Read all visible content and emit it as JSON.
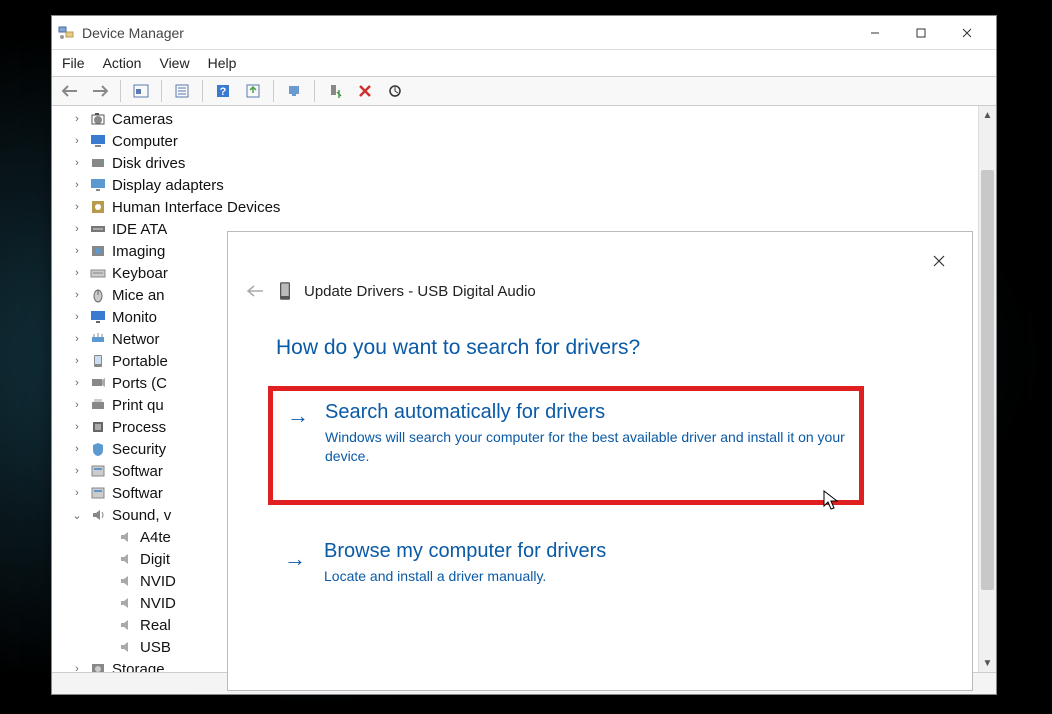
{
  "window": {
    "title": "Device Manager",
    "menu": {
      "file": "File",
      "action": "Action",
      "view": "View",
      "help": "Help"
    }
  },
  "tree": [
    {
      "label": "Cameras",
      "icon": "camera",
      "exp": ">"
    },
    {
      "label": "Computer",
      "icon": "computer",
      "exp": ">"
    },
    {
      "label": "Disk drives",
      "icon": "disk",
      "exp": ">"
    },
    {
      "label": "Display adapters",
      "icon": "display",
      "exp": ">"
    },
    {
      "label": "Human Interface Devices",
      "icon": "hid",
      "exp": ">"
    },
    {
      "label": "IDE ATA",
      "icon": "ide",
      "exp": ">"
    },
    {
      "label": "Imaging",
      "icon": "imaging",
      "exp": ">"
    },
    {
      "label": "Keyboar",
      "icon": "keyboard",
      "exp": ">"
    },
    {
      "label": "Mice an",
      "icon": "mouse",
      "exp": ">"
    },
    {
      "label": "Monito",
      "icon": "monitor",
      "exp": ">"
    },
    {
      "label": "Networ",
      "icon": "network",
      "exp": ">"
    },
    {
      "label": "Portable",
      "icon": "portable",
      "exp": ">"
    },
    {
      "label": "Ports (C",
      "icon": "ports",
      "exp": ">"
    },
    {
      "label": "Print qu",
      "icon": "print",
      "exp": ">"
    },
    {
      "label": "Process",
      "icon": "processor",
      "exp": ">"
    },
    {
      "label": "Security",
      "icon": "security",
      "exp": ">"
    },
    {
      "label": "Softwar",
      "icon": "software",
      "exp": ">"
    },
    {
      "label": "Softwar",
      "icon": "software",
      "exp": ">"
    },
    {
      "label": "Sound, v",
      "icon": "sound",
      "exp": "v"
    },
    {
      "label": "A4te",
      "icon": "speaker",
      "child": true
    },
    {
      "label": "Digit",
      "icon": "speaker",
      "child": true
    },
    {
      "label": "NVID",
      "icon": "speaker",
      "child": true
    },
    {
      "label": "NVID",
      "icon": "speaker",
      "child": true
    },
    {
      "label": "Real",
      "icon": "speaker",
      "child": true
    },
    {
      "label": "USB",
      "icon": "speaker",
      "child": true
    },
    {
      "label": "Storage",
      "icon": "storage",
      "exp": ">"
    }
  ],
  "dialog": {
    "title": "Update Drivers - USB Digital Audio",
    "heading": "How do you want to search for drivers?",
    "opt1_title": "Search automatically for drivers",
    "opt1_desc": "Windows will search your computer for the best available driver and install it on your device.",
    "opt2_title": "Browse my computer for drivers",
    "opt2_desc": "Locate and install a driver manually."
  }
}
